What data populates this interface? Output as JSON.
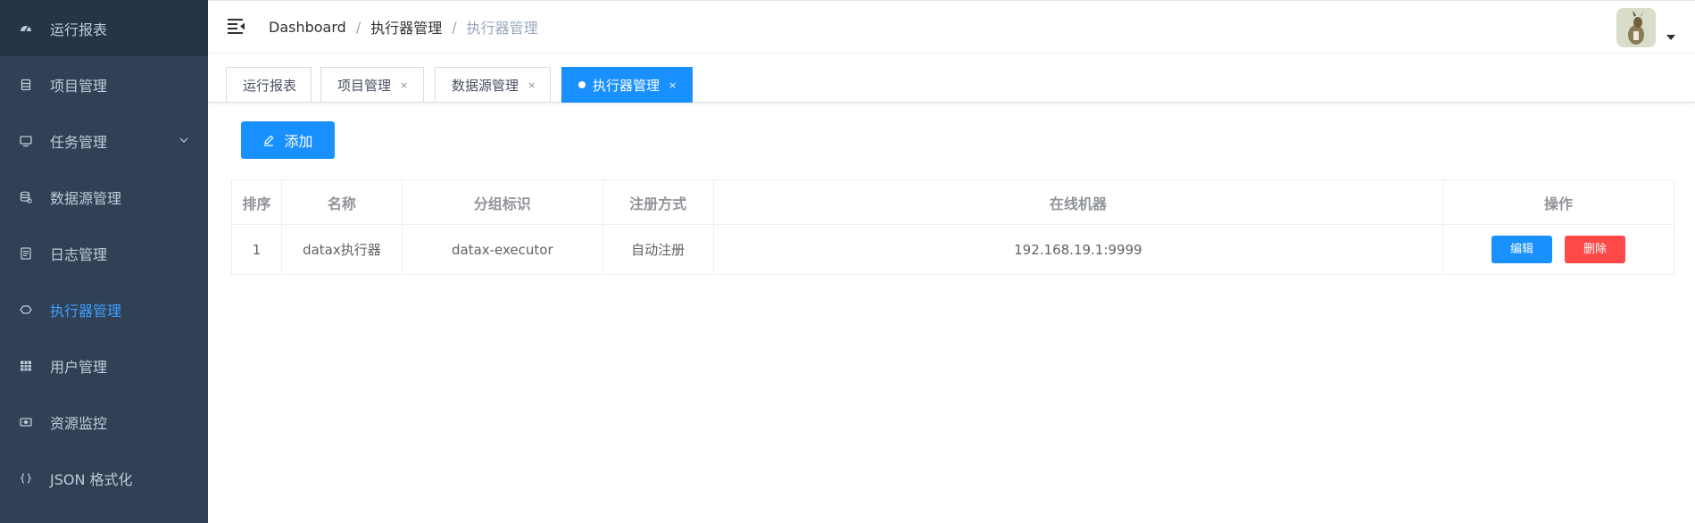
{
  "sidebar": {
    "items": [
      {
        "label": "运行报表",
        "icon": "dashboard-icon"
      },
      {
        "label": "项目管理",
        "icon": "project-icon"
      },
      {
        "label": "任务管理",
        "icon": "monitor-icon"
      },
      {
        "label": "数据源管理",
        "icon": "database-icon"
      },
      {
        "label": "日志管理",
        "icon": "document-icon"
      },
      {
        "label": "执行器管理",
        "icon": "executor-icon"
      },
      {
        "label": "用户管理",
        "icon": "grid-icon"
      },
      {
        "label": "资源监控",
        "icon": "resource-icon"
      },
      {
        "label": "JSON 格式化",
        "icon": "braces-icon"
      }
    ],
    "active_index": 5,
    "colors": {
      "background": "#304156",
      "text": "#bfcbd9",
      "active": "#409eff"
    }
  },
  "navbar": {
    "breadcrumb": {
      "items": [
        "Dashboard",
        "执行器管理",
        "执行器管理"
      ],
      "separator": "/"
    }
  },
  "tags": [
    {
      "label": "运行报表",
      "closable": false,
      "active": false
    },
    {
      "label": "项目管理",
      "closable": true,
      "active": false
    },
    {
      "label": "数据源管理",
      "closable": true,
      "active": false
    },
    {
      "label": "执行器管理",
      "closable": true,
      "active": true
    }
  ],
  "tag_close_glyph": "×",
  "toolbar": {
    "add_label": "添加"
  },
  "table": {
    "headers": [
      "排序",
      "名称",
      "分组标识",
      "注册方式",
      "在线机器",
      "操作"
    ],
    "rows": [
      {
        "order": "1",
        "name": "datax执行器",
        "group": "datax-executor",
        "registration": "自动注册",
        "machines": "192.168.19.1:9999"
      }
    ],
    "actions": {
      "edit": "编辑",
      "delete": "删除"
    }
  },
  "colors": {
    "primary": "#1890ff",
    "danger": "#ff4949"
  }
}
